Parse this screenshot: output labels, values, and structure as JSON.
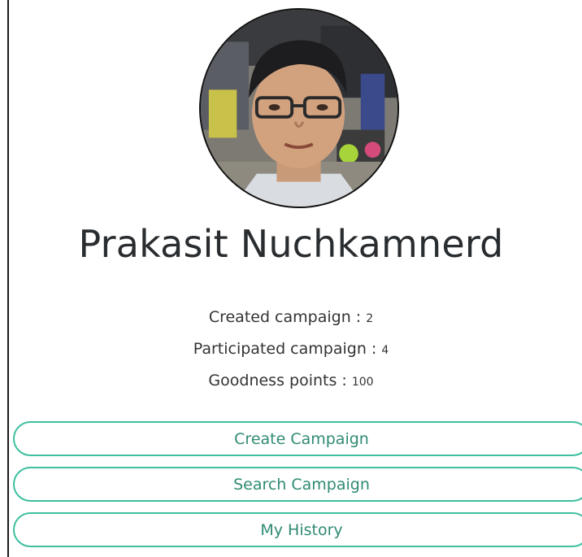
{
  "profile": {
    "name": "Prakasit Nuchkamnerd",
    "avatar_icon": "user-photo"
  },
  "stats": [
    {
      "label": "Created campaign : ",
      "value": "2"
    },
    {
      "label": "Participated campaign : ",
      "value": "4"
    },
    {
      "label": "Goodness points : ",
      "value": "100"
    }
  ],
  "actions": {
    "create_label": "Create Campaign",
    "search_label": "Search Campaign",
    "history_label": "My History"
  },
  "colors": {
    "accent": "#3dbfa0",
    "button_text": "#2f8a73",
    "text": "#2a2d30"
  }
}
